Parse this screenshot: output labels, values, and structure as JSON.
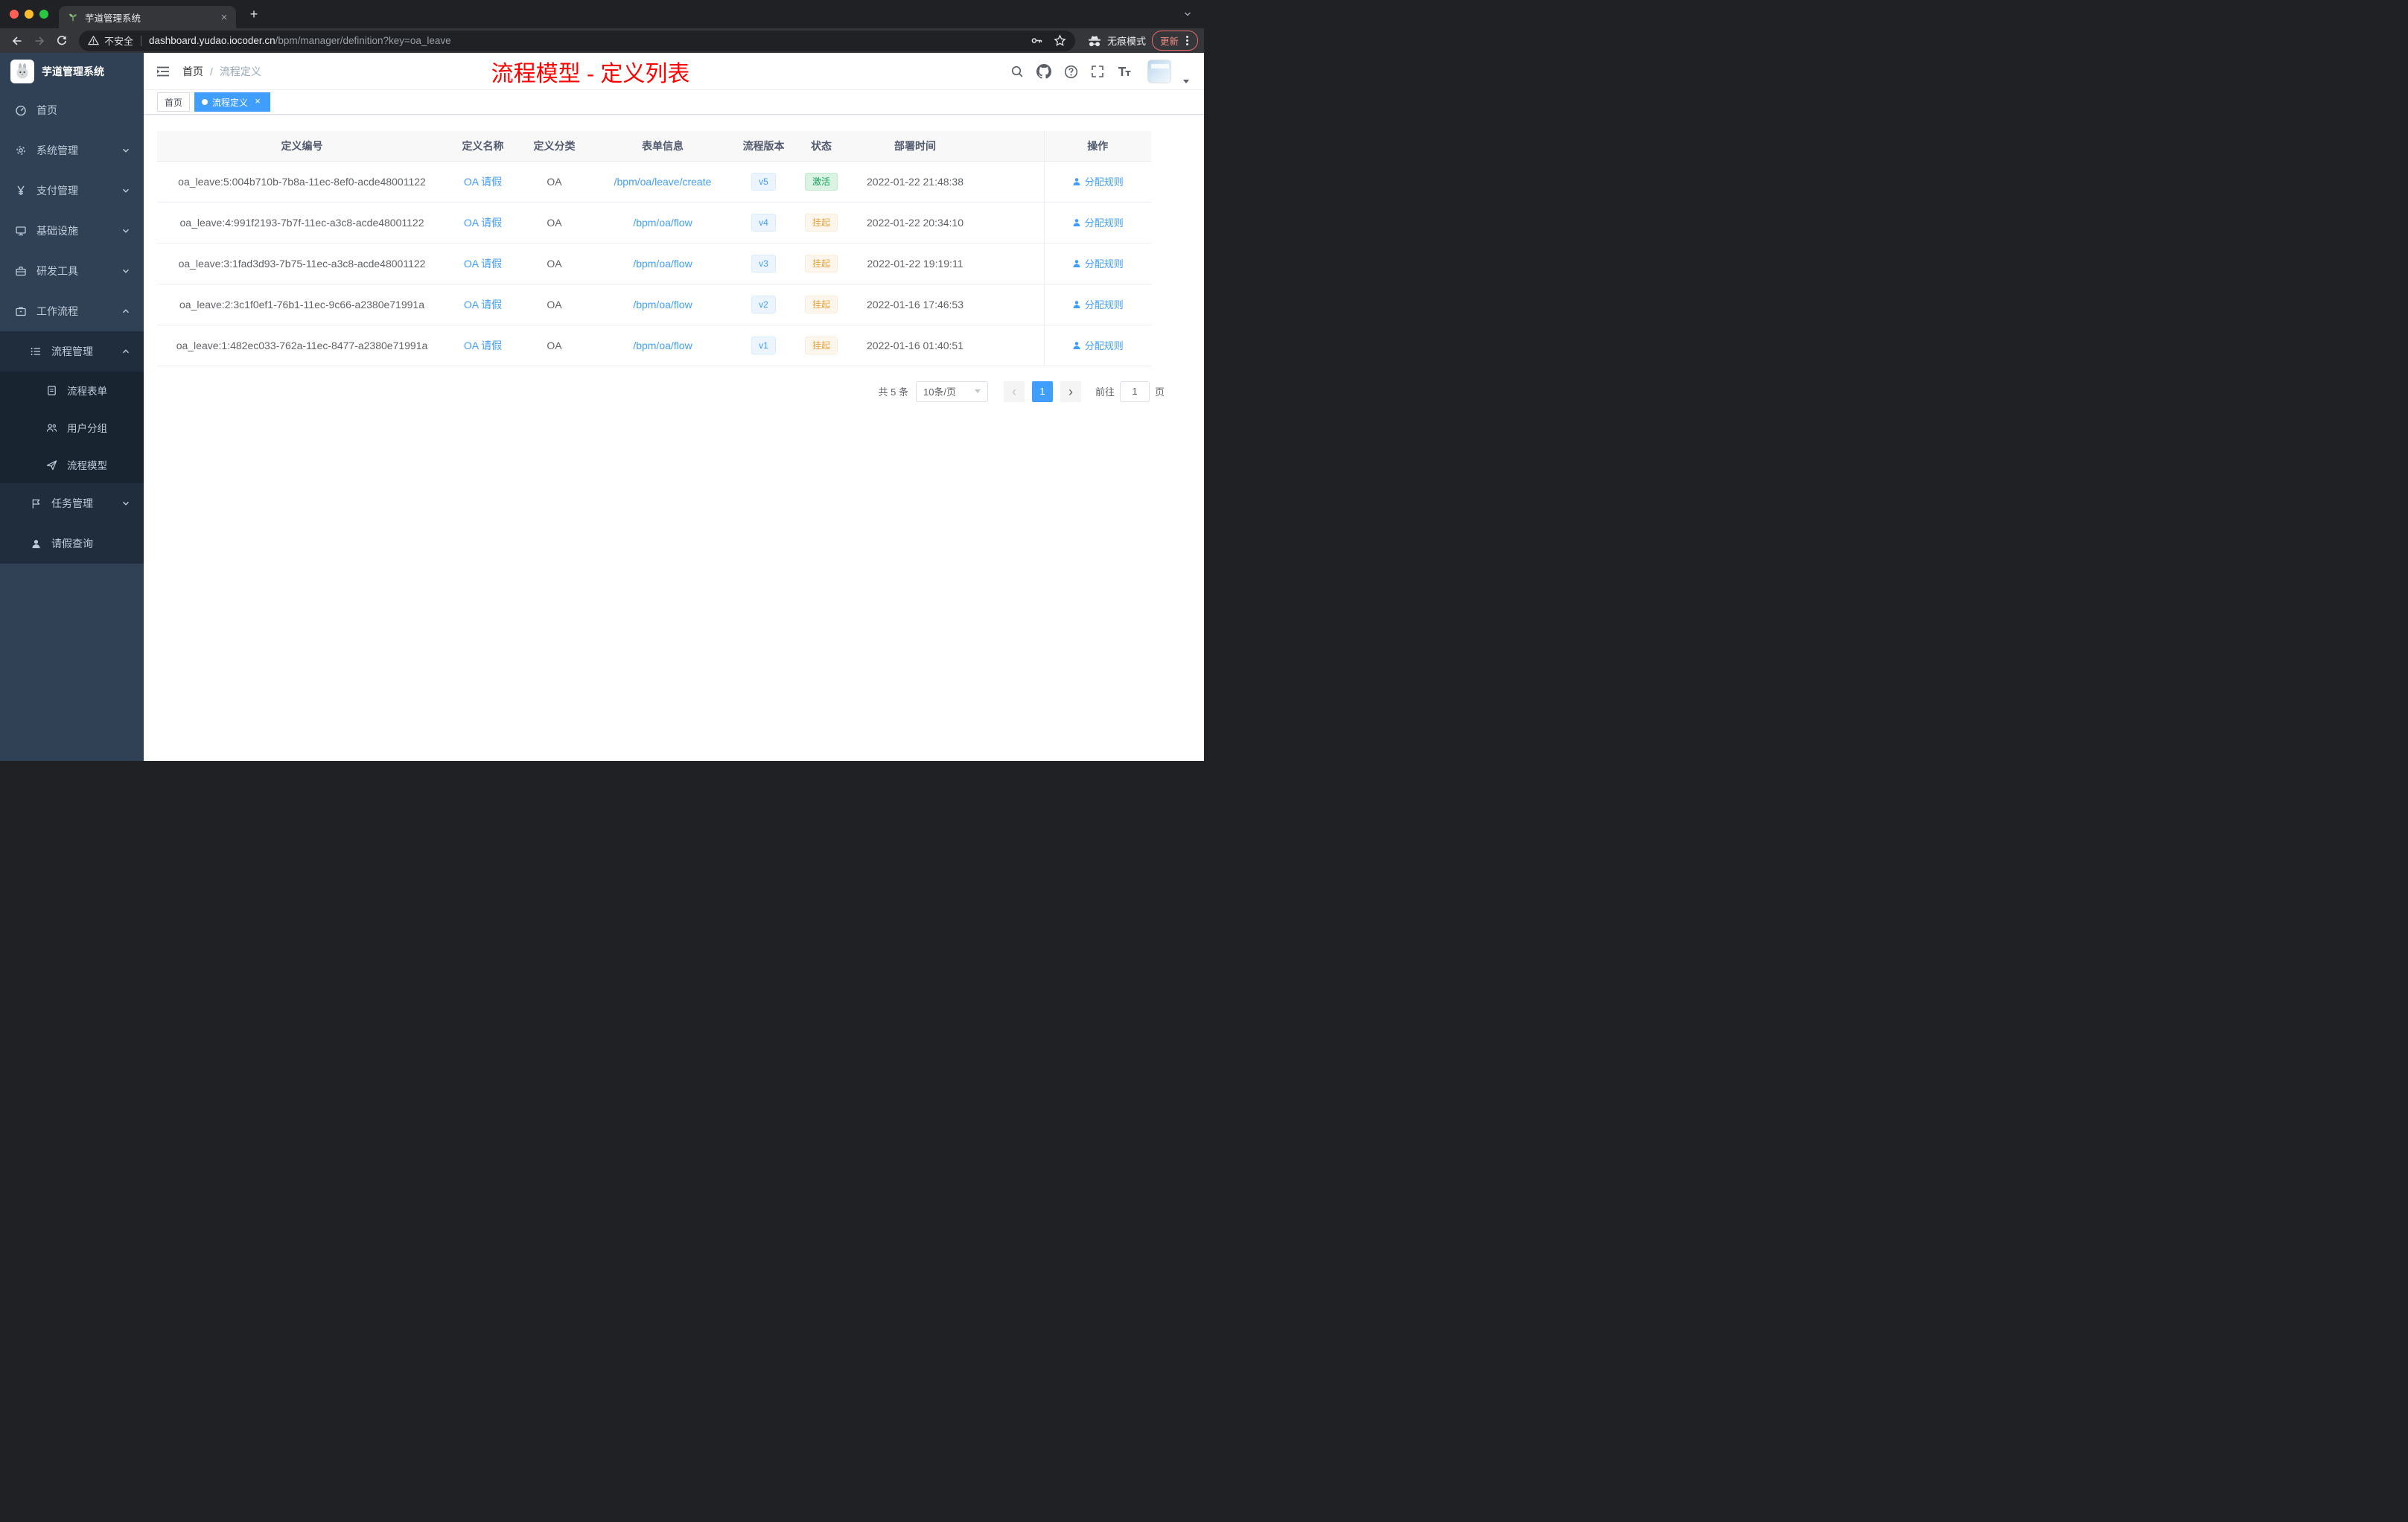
{
  "browser": {
    "tab_title": "芋道管理系统",
    "security_label": "不安全",
    "url_domain": "dashboard.yudao.iocoder.cn",
    "url_path": "/bpm/manager/definition?key=oa_leave",
    "incognito_label": "无痕模式",
    "update_label": "更新"
  },
  "sidebar": {
    "app_title": "芋道管理系统",
    "items": [
      {
        "label": "首页"
      },
      {
        "label": "系统管理"
      },
      {
        "label": "支付管理"
      },
      {
        "label": "基础设施"
      },
      {
        "label": "研发工具"
      },
      {
        "label": "工作流程"
      },
      {
        "label": "流程管理"
      },
      {
        "label": "流程表单"
      },
      {
        "label": "用户分组"
      },
      {
        "label": "流程模型"
      },
      {
        "label": "任务管理"
      },
      {
        "label": "请假查询"
      }
    ]
  },
  "header": {
    "breadcrumb": {
      "home": "首页",
      "current": "流程定义"
    },
    "page_title": "流程模型 - 定义列表"
  },
  "tags_view": {
    "tags": [
      {
        "label": "首页"
      },
      {
        "label": "流程定义"
      }
    ]
  },
  "table": {
    "columns": [
      "定义编号",
      "定义名称",
      "定义分类",
      "表单信息",
      "流程版本",
      "状态",
      "部署时间",
      "操作"
    ],
    "rows": [
      {
        "id": "oa_leave:5:004b710b-7b8a-11ec-8ef0-acde48001122",
        "name": "OA 请假",
        "category": "OA",
        "form": "/bpm/oa/leave/create",
        "version": "v5",
        "status": "激活",
        "status_type": "success",
        "deployed_at": "2022-01-22 21:48:38",
        "action": "分配规则"
      },
      {
        "id": "oa_leave:4:991f2193-7b7f-11ec-a3c8-acde48001122",
        "name": "OA 请假",
        "category": "OA",
        "form": "/bpm/oa/flow",
        "version": "v4",
        "status": "挂起",
        "status_type": "warning",
        "deployed_at": "2022-01-22 20:34:10",
        "action": "分配规则"
      },
      {
        "id": "oa_leave:3:1fad3d93-7b75-11ec-a3c8-acde48001122",
        "name": "OA 请假",
        "category": "OA",
        "form": "/bpm/oa/flow",
        "version": "v3",
        "status": "挂起",
        "status_type": "warning",
        "deployed_at": "2022-01-22 19:19:11",
        "action": "分配规则"
      },
      {
        "id": "oa_leave:2:3c1f0ef1-76b1-11ec-9c66-a2380e71991a",
        "name": "OA 请假",
        "category": "OA",
        "form": "/bpm/oa/flow",
        "version": "v2",
        "status": "挂起",
        "status_type": "warning",
        "deployed_at": "2022-01-16 17:46:53",
        "action": "分配规则"
      },
      {
        "id": "oa_leave:1:482ec033-762a-11ec-8477-a2380e71991a",
        "name": "OA 请假",
        "category": "OA",
        "form": "/bpm/oa/flow",
        "version": "v1",
        "status": "挂起",
        "status_type": "warning",
        "deployed_at": "2022-01-16 01:40:51",
        "action": "分配规则"
      }
    ]
  },
  "pagination": {
    "total": "共 5 条",
    "page_size": "10条/页",
    "current_page": "1",
    "goto_label": "前往",
    "goto_value": "1",
    "page_unit": "页"
  },
  "colors": {
    "accent_blue": "#409eff",
    "title_red": "#ff0000",
    "sidebar_bg": "#304156",
    "success_green": "#16a05d",
    "warning_orange": "#e6a23c"
  }
}
